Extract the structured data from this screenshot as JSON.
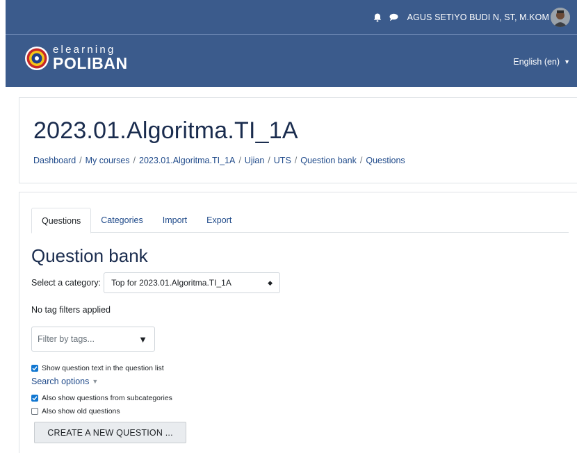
{
  "topbar": {
    "user_name": "AGUS SETIYO BUDI N, ST, M.KOM",
    "bell_icon": "bell-icon",
    "message_icon": "chat-bubble-icon",
    "bg_color": "#3b5b8c"
  },
  "brand": {
    "logo_small": "elearning",
    "logo_big": "POLIBAN",
    "language": "English (en)"
  },
  "header": {
    "course_title": "2023.01.Algoritma.TI_1A",
    "breadcrumb": [
      "Dashboard",
      "My courses",
      "2023.01.Algoritma.TI_1A",
      "Ujian",
      "UTS",
      "Question bank",
      "Questions"
    ],
    "separator": "/"
  },
  "tabs": [
    {
      "label": "Questions",
      "active": true
    },
    {
      "label": "Categories",
      "active": false
    },
    {
      "label": "Import",
      "active": false
    },
    {
      "label": "Export",
      "active": false
    }
  ],
  "main": {
    "heading": "Question bank",
    "category_label": "Select a category:",
    "category_value": "Top for 2023.01.Algoritma.TI_1A",
    "no_tags": "No tag filters applied",
    "tag_placeholder": "Filter by tags...",
    "show_text_label": "Show question text in the question list",
    "show_text_checked": true,
    "search_options": "Search options",
    "subcat_label": "Also show questions from subcategories",
    "subcat_checked": true,
    "old_label": "Also show old questions",
    "old_checked": false,
    "create_button": "CREATE A NEW QUESTION ..."
  },
  "colors": {
    "accent": "#1177d1",
    "link": "#1f4a8a",
    "heading": "#1a2c4e"
  }
}
